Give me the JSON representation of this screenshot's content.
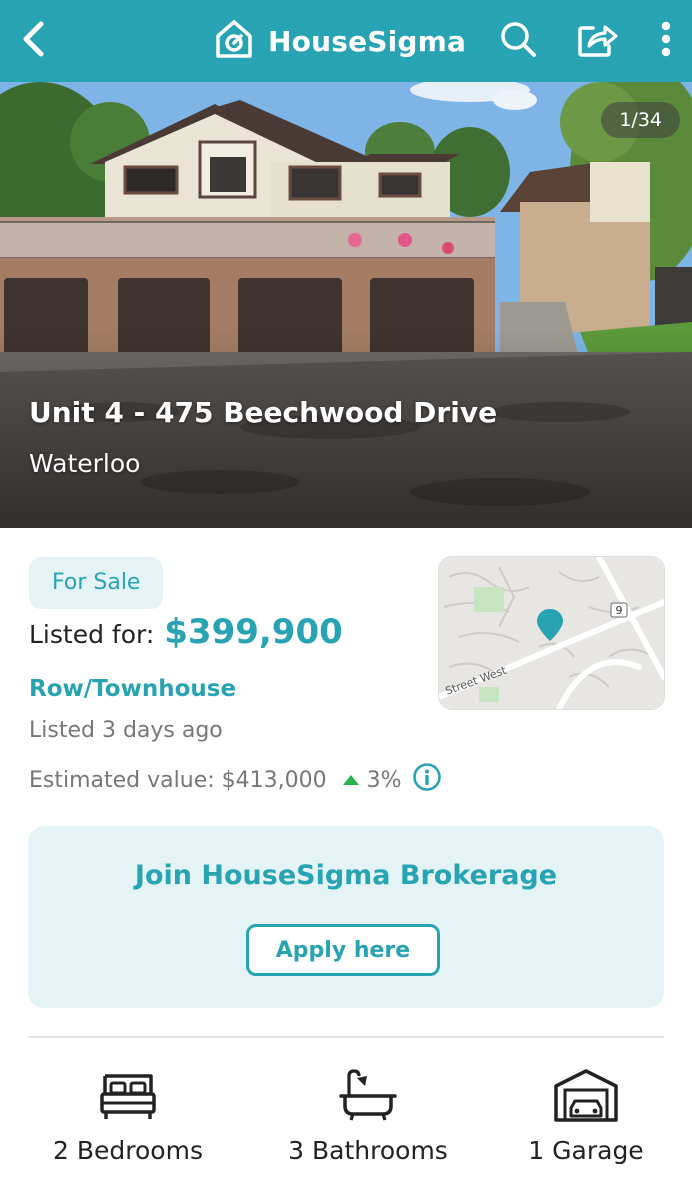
{
  "header": {
    "brand_name": "HouseSigma",
    "back_icon": "chevron-left-icon",
    "search_icon": "search-icon",
    "share_icon": "share-icon",
    "more_icon": "more-vertical-icon",
    "bar_color": "#28a3b3"
  },
  "hero": {
    "photo_counter": "1/34",
    "address": "Unit 4 - 475 Beechwood Drive",
    "city": "Waterloo"
  },
  "listing": {
    "status": "For Sale",
    "listed_label": "Listed for:",
    "price": "$399,900",
    "property_type": "Row/Townhouse",
    "listed_ago": "Listed 3 days ago",
    "estimated_label": "Estimated value: $413,000",
    "estimated_change": "3%",
    "change_direction": "up",
    "change_color": "#2bb24c"
  },
  "map": {
    "street_label": "Street West",
    "route_badge": "9"
  },
  "brokerage": {
    "title": "Join HouseSigma Brokerage",
    "button_label": "Apply here"
  },
  "features": [
    {
      "icon": "bed-icon",
      "label": "2 Bedrooms"
    },
    {
      "icon": "bathtub-icon",
      "label": "3 Bathrooms"
    },
    {
      "icon": "garage-icon",
      "label": "1 Garage"
    }
  ],
  "colors": {
    "accent": "#28a3b3",
    "accent_light": "#e4f4f6"
  }
}
